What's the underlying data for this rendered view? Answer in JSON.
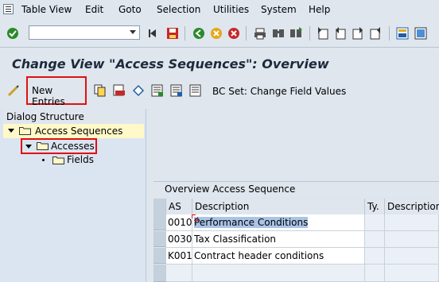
{
  "menu": {
    "items": [
      "Table View",
      "Edit",
      "Goto",
      "Selection",
      "Utilities",
      "System",
      "Help"
    ]
  },
  "toolbar": {
    "command_value": "",
    "icons": [
      "enter-icon",
      "back-icon",
      "save-icon",
      "back-nav-icon",
      "exit-icon",
      "cancel-icon",
      "print-icon",
      "find-icon",
      "find-next-icon",
      "first-page-icon",
      "previous-page-icon",
      "next-page-icon",
      "last-page-icon",
      "layout-icon",
      "help-icon"
    ]
  },
  "title": "Change View \"Access Sequences\": Overview",
  "app_toolbar": {
    "new_entries": "New Entries",
    "bc_set": "BC Set: Change Field Values"
  },
  "dialog": {
    "header": "Dialog Structure",
    "items": [
      {
        "label": "Access Sequences"
      },
      {
        "label": "Accesses"
      },
      {
        "label": "Fields"
      }
    ]
  },
  "table": {
    "title": "Overview Access Sequence",
    "columns": [
      "AS",
      "Description",
      "Ty.",
      "Description"
    ],
    "rows": [
      {
        "as": "0010",
        "description": "Performance Conditions"
      },
      {
        "as": "0030",
        "description": "Tax Classification"
      },
      {
        "as": "K001",
        "description": "Contract header conditions"
      }
    ]
  },
  "colors": {
    "highlight": "#e01010",
    "selected_row": "#fff8c8"
  }
}
